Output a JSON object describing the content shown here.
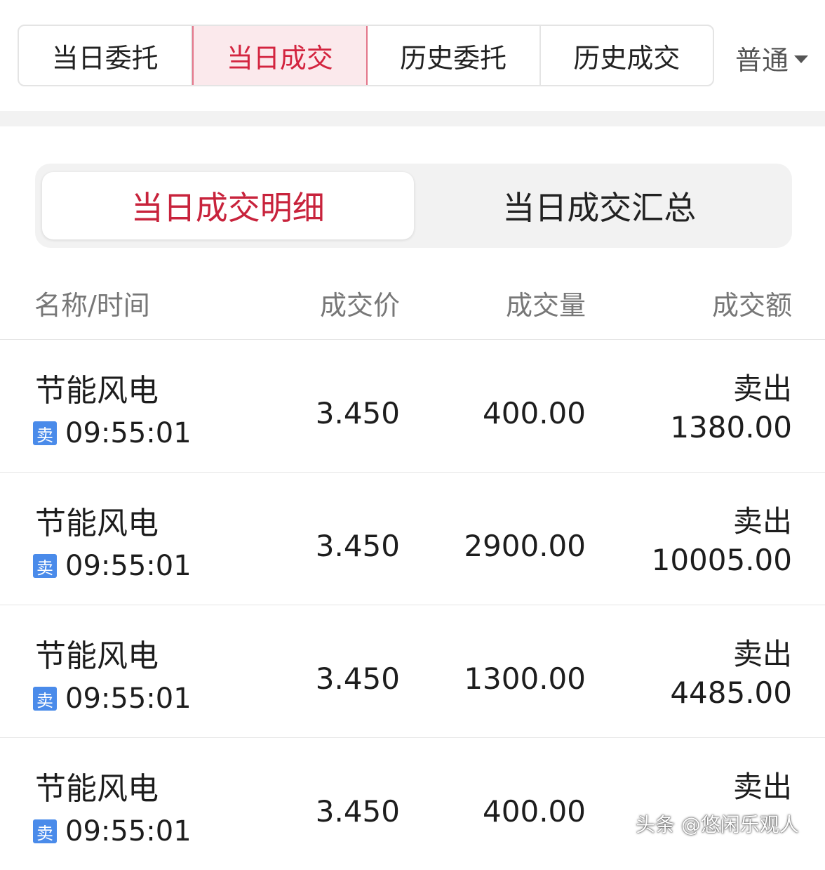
{
  "top_tabs": [
    "当日委托",
    "当日成交",
    "历史委托",
    "历史成交"
  ],
  "mode_selector": "普通",
  "segment": {
    "left": "当日成交明细",
    "right": "当日成交汇总"
  },
  "table": {
    "headers": [
      "名称/时间",
      "成交价",
      "成交量",
      "成交额"
    ],
    "rows": [
      {
        "name": "节能风电",
        "badge": "卖",
        "time": "09:55:01",
        "price": "3.450",
        "qty": "400.00",
        "side": "卖出",
        "amount": "1380.00"
      },
      {
        "name": "节能风电",
        "badge": "卖",
        "time": "09:55:01",
        "price": "3.450",
        "qty": "2900.00",
        "side": "卖出",
        "amount": "10005.00"
      },
      {
        "name": "节能风电",
        "badge": "卖",
        "time": "09:55:01",
        "price": "3.450",
        "qty": "1300.00",
        "side": "卖出",
        "amount": "4485.00"
      },
      {
        "name": "节能风电",
        "badge": "卖",
        "time": "09:55:01",
        "price": "3.450",
        "qty": "400.00",
        "side": "卖出",
        "amount": ""
      }
    ]
  },
  "watermark": "头条 @悠闲乐观人",
  "colors": {
    "accent": "#d3243f",
    "accent_bg": "#fbe9ec",
    "badge": "#4a8bea"
  }
}
